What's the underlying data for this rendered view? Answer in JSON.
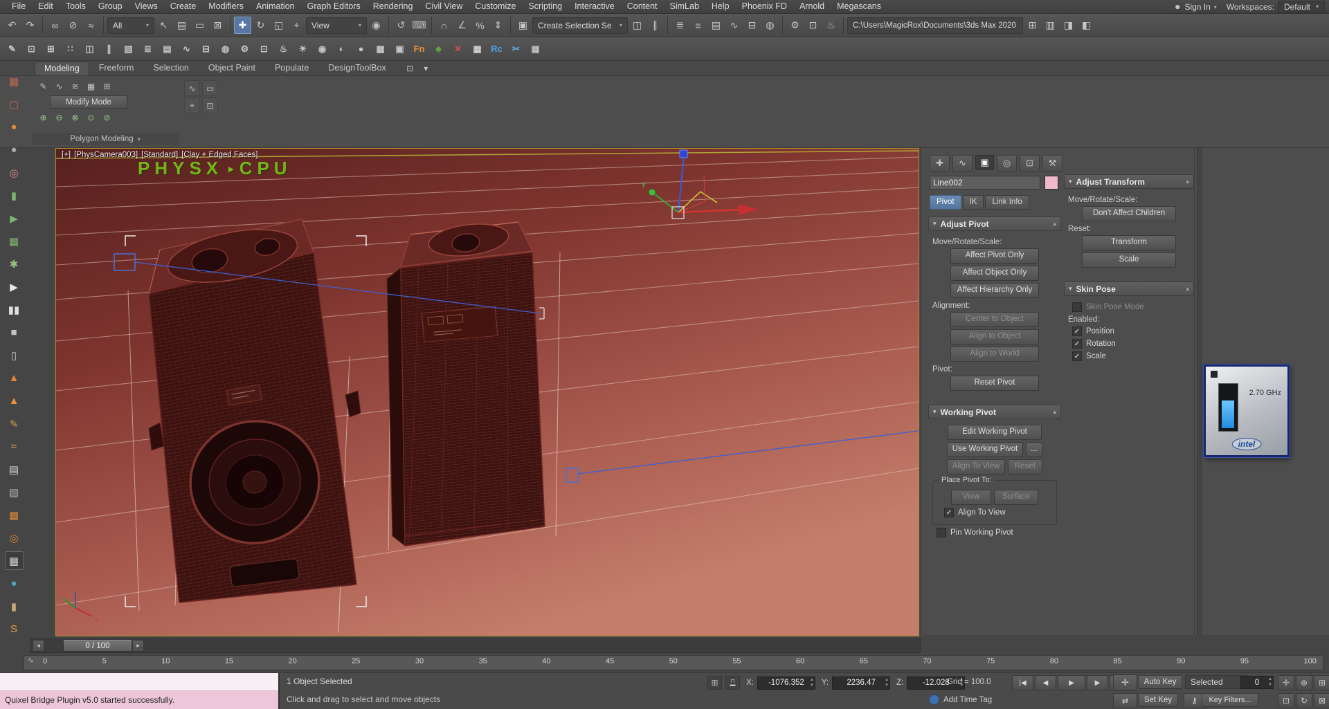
{
  "colors": {
    "active_tool_blue": "#5878a2",
    "viewport_border_yellow": "#b08f2e",
    "watermark_green": "#76b31c",
    "listener_pink": "#eec6da",
    "spline_blue": "#3e5fd0",
    "pivot_tab_blue": "#54749c",
    "cpu_bar_blue": "#1f8de0"
  },
  "menubar": {
    "items": [
      "File",
      "Edit",
      "Tools",
      "Group",
      "Views",
      "Create",
      "Modifiers",
      "Animation",
      "Graph Editors",
      "Rendering",
      "Civil View",
      "Customize",
      "Scripting",
      "Interactive",
      "Content",
      "SimLab",
      "Help",
      "Phoenix FD",
      "Arnold",
      "Megascans"
    ],
    "sign_in_label": "Sign In",
    "workspaces_label": "Workspaces:",
    "workspaces_value": "Default"
  },
  "toolbar_main": {
    "selection_filter_value": "All",
    "ref_coord_value": "View",
    "named_sets_value": "Create Selection Se",
    "project_path": "C:\\Users\\MagicRox\\Documents\\3ds Max 2020",
    "history_icons": [
      {
        "name": "undo-icon",
        "glyph": "↶"
      },
      {
        "name": "redo-icon",
        "glyph": "↷"
      }
    ],
    "link_icons": [
      {
        "name": "select-and-link-icon",
        "glyph": "∞"
      },
      {
        "name": "unlink-selection-icon",
        "glyph": "⊘"
      },
      {
        "name": "bind-to-space-warp-icon",
        "glyph": "≈"
      }
    ],
    "select_icons": [
      {
        "name": "select-object-icon",
        "glyph": "↖"
      },
      {
        "name": "select-by-name-icon",
        "glyph": "▤"
      },
      {
        "name": "rectangular-selection-region-icon",
        "glyph": "▭"
      },
      {
        "name": "window-crossing-icon",
        "glyph": "⊠"
      }
    ],
    "transform_icons": [
      {
        "name": "select-and-move-icon",
        "glyph": "✚",
        "active": true
      },
      {
        "name": "select-and-rotate-icon",
        "glyph": "↻"
      },
      {
        "name": "select-and-scale-icon",
        "glyph": "◱"
      },
      {
        "name": "select-and-place-icon",
        "glyph": "⌖"
      }
    ],
    "center_icons": [
      {
        "name": "use-pivot-point-center-icon",
        "glyph": "◉"
      }
    ],
    "manip_icons": [
      {
        "name": "select-and-manipulate-icon",
        "glyph": "↺"
      },
      {
        "name": "keyboard-shortcut-override-icon",
        "glyph": "⌨"
      }
    ],
    "snap_icons": [
      {
        "name": "snaps-toggle-icon",
        "glyph": "∩"
      },
      {
        "name": "angle-snap-icon",
        "glyph": "∠"
      },
      {
        "name": "percent-snap-icon",
        "glyph": "%"
      },
      {
        "name": "spinner-snap-icon",
        "glyph": "⇕"
      }
    ],
    "sets_icons": [
      {
        "name": "edit-named-selection-sets-icon",
        "glyph": "▣"
      }
    ],
    "mirror_icons": [
      {
        "name": "mirror-icon",
        "glyph": "◫"
      },
      {
        "name": "align-icon",
        "glyph": "∥"
      }
    ],
    "explorer_icons": [
      {
        "name": "scene-explorer-icon",
        "glyph": "≣"
      },
      {
        "name": "layer-explorer-icon",
        "glyph": "≡"
      },
      {
        "name": "ribbon-toggle-icon",
        "glyph": "▤"
      },
      {
        "name": "curve-editor-icon",
        "glyph": "∿"
      },
      {
        "name": "schematic-view-icon",
        "glyph": "⊟"
      },
      {
        "name": "material-editor-icon",
        "glyph": "◍"
      }
    ],
    "render_icons": [
      {
        "name": "render-setup-icon",
        "glyph": "⚙"
      },
      {
        "name": "rendered-frame-window-icon",
        "glyph": "⊡"
      },
      {
        "name": "render-production-icon",
        "glyph": "♨"
      }
    ],
    "end_icons": [
      {
        "name": "project-folder-icon",
        "glyph": "⊞"
      },
      {
        "name": "asset-library-icon",
        "glyph": "▥"
      },
      {
        "name": "import-icon",
        "glyph": "◨"
      },
      {
        "name": "export-icon",
        "glyph": "◧"
      }
    ]
  },
  "toolbar_secondary": {
    "icons": [
      {
        "name": "selection-paint-icon",
        "glyph": "✎"
      },
      {
        "name": "snapshot-icon",
        "glyph": "⊡"
      },
      {
        "name": "array-tool-icon",
        "glyph": "⊞"
      },
      {
        "name": "spacing-tool-icon",
        "glyph": "∷"
      },
      {
        "name": "mirror-tool-icon",
        "glyph": "◫"
      },
      {
        "name": "align-tool-icon",
        "glyph": "∥"
      },
      {
        "name": "color-clipboard-icon",
        "glyph": "▧"
      },
      {
        "name": "layer-manager-icon",
        "glyph": "≣"
      },
      {
        "name": "graphite-ribbon-icon",
        "glyph": "▤"
      },
      {
        "name": "curve-editor-2-icon",
        "glyph": "∿"
      },
      {
        "name": "schematic-view-2-icon",
        "glyph": "⊟"
      },
      {
        "name": "material-editor-2-icon",
        "glyph": "◍"
      },
      {
        "name": "render-setup-2-icon",
        "glyph": "⚙"
      },
      {
        "name": "rendered-frame-2-icon",
        "glyph": "⊡"
      },
      {
        "name": "render-teapot-icon",
        "glyph": "♨"
      },
      {
        "name": "light-tool-icon",
        "glyph": "☀"
      },
      {
        "name": "camera-tool-icon",
        "glyph": "◉"
      },
      {
        "name": "environment-icon",
        "glyph": "◐"
      },
      {
        "name": "sphere-preview-icon",
        "glyph": "●"
      },
      {
        "name": "uvw-edit-icon",
        "glyph": "▦"
      },
      {
        "name": "state-sets-icon",
        "glyph": "▣"
      },
      {
        "name": "plugin-fn-icon",
        "glyph": "Fn",
        "color": "#e8923a"
      },
      {
        "name": "forest-pack-icon",
        "glyph": "♣",
        "color": "#63b043"
      },
      {
        "name": "plugin-x-icon",
        "glyph": "✕",
        "color": "#d25050"
      },
      {
        "name": "grid-plugin-icon",
        "glyph": "▦",
        "color": "#cfcfcf"
      },
      {
        "name": "railclone-icon",
        "glyph": "Rc",
        "color": "#4f9fe0"
      },
      {
        "name": "scissors-plugin-icon",
        "glyph": "✂",
        "color": "#5fb3dc"
      },
      {
        "name": "grid2-plugin-icon",
        "glyph": "▦",
        "color": "#bdbdbd"
      }
    ]
  },
  "ribbon": {
    "tabs": [
      {
        "name": "tab-modeling",
        "label": "Modeling",
        "active": true
      },
      {
        "name": "tab-freeform",
        "label": "Freeform"
      },
      {
        "name": "tab-selection",
        "label": "Selection"
      },
      {
        "name": "tab-object-paint",
        "label": "Object Paint"
      },
      {
        "name": "tab-populate",
        "label": "Populate"
      },
      {
        "name": "tab-designtoolbox",
        "label": "DesignToolBox"
      }
    ],
    "config_icons": [
      {
        "name": "ribbon-config-icon",
        "glyph": "⊡"
      },
      {
        "name": "ribbon-minimize-icon",
        "glyph": "▾"
      }
    ],
    "poly_panel": {
      "tool_icons_top": [
        {
          "name": "edit-poly-mode-icon",
          "glyph": "✎"
        },
        {
          "name": "swift-loop-icon",
          "glyph": "∿"
        },
        {
          "name": "paint-connect-icon",
          "glyph": "≋"
        },
        {
          "name": "quad-cap-icon",
          "glyph": "▦"
        },
        {
          "name": "subdivide-icon",
          "glyph": "⊞"
        }
      ],
      "modify_mode_label": "Modify Mode",
      "tool_icons_bottom": [
        {
          "name": "attach-icon",
          "glyph": "⊕"
        },
        {
          "name": "detach-icon",
          "glyph": "⊖"
        },
        {
          "name": "collapse-icon",
          "glyph": "⊗"
        },
        {
          "name": "weld-icon",
          "glyph": "⊙"
        },
        {
          "name": "slice-icon",
          "glyph": "⊘"
        }
      ],
      "footer_label": "Polygon Modeling"
    },
    "extra_icons": [
      {
        "name": "freeform-tool-icon",
        "glyph": "∿"
      },
      {
        "name": "selection-tool-icon",
        "glyph": "▭"
      },
      {
        "name": "pivot-tool-icon",
        "glyph": "⌖"
      },
      {
        "name": "display-tool-icon",
        "glyph": "⊡"
      }
    ]
  },
  "left_toolbar": {
    "icons": [
      {
        "name": "cube-tool-icon",
        "glyph": "▦",
        "color": "#c06a55"
      },
      {
        "name": "cube-outline-icon",
        "glyph": "▢",
        "color": "#c06a55"
      },
      {
        "name": "sphere-orange-icon",
        "glyph": "●",
        "color": "#d98a3a"
      },
      {
        "name": "sphere-gray-icon",
        "glyph": "●",
        "color": "#a8a8a8"
      },
      {
        "name": "torus-pink-icon",
        "glyph": "◎",
        "color": "#d98a8a"
      },
      {
        "name": "capsule-green-icon",
        "glyph": "▮",
        "color": "#7fb370"
      },
      {
        "name": "arrow-green-icon",
        "glyph": "▶",
        "color": "#7fb370"
      },
      {
        "name": "grid-green-icon",
        "glyph": "▦",
        "color": "#7fb370"
      },
      {
        "name": "star-green-icon",
        "glyph": "✱",
        "color": "#8fc37f"
      },
      {
        "name": "play-icon",
        "glyph": "▶",
        "color": "#e8e8e8"
      },
      {
        "name": "pause-icon",
        "glyph": "▮▮",
        "color": "#e0e0e0"
      },
      {
        "name": "stop-icon",
        "glyph": "■",
        "color": "#c4c4c4"
      },
      {
        "name": "trash-icon",
        "glyph": "▯",
        "color": "#c4c4c4"
      },
      {
        "name": "flame-icon",
        "glyph": "▲",
        "color": "#e8833a"
      },
      {
        "name": "flame-sim-icon",
        "glyph": "▲",
        "color": "#e8933a"
      },
      {
        "name": "brush-orange-icon",
        "glyph": "✎",
        "color": "#d89a4a"
      },
      {
        "name": "wave-orange-icon",
        "glyph": "≈",
        "color": "#e8a04a"
      },
      {
        "name": "clipboard-icon",
        "glyph": "▤",
        "color": "#d8d8d8"
      },
      {
        "name": "panel-gray-icon",
        "glyph": "▧",
        "color": "#b0b0b0"
      },
      {
        "name": "box-orange-icon",
        "glyph": "▦",
        "color": "#d8893a"
      },
      {
        "name": "rings-orange-icon",
        "glyph": "◎",
        "color": "#d8893a"
      },
      {
        "name": "grid-snap-icon",
        "glyph": "▦",
        "color": "#d0d0d0",
        "active": true
      },
      {
        "name": "drop-teal-icon",
        "glyph": "●",
        "color": "#4aa8b8"
      },
      {
        "name": "barrel-icon",
        "glyph": "▮",
        "color": "#c8a878"
      },
      {
        "name": "s-orange-icon",
        "glyph": "S",
        "color": "#e8a04a"
      }
    ]
  },
  "viewport": {
    "label_plus": "[+]",
    "label_camera": "[PhysCamera003]",
    "label_style": "[Standard]",
    "label_shading": "[Clay + Edged Faces]",
    "watermark_primary": "PHYSX",
    "watermark_separator": "▸",
    "watermark_secondary": "CPU",
    "gizmo_axis_label": "Y",
    "tripod_axis_label": "x"
  },
  "command_panel": {
    "tab_icons": [
      {
        "name": "create-tab-icon",
        "glyph": "✚"
      },
      {
        "name": "modify-tab-icon",
        "glyph": "∿"
      },
      {
        "name": "hierarchy-tab-icon",
        "glyph": "▣",
        "active": true
      },
      {
        "name": "motion-tab-icon",
        "glyph": "◎"
      },
      {
        "name": "display-tab-icon",
        "glyph": "⊡"
      },
      {
        "name": "utilities-tab-icon",
        "glyph": "⚒"
      }
    ],
    "object_name": "Line002",
    "page_tabs": [
      {
        "name": "tab-pivot",
        "label": "Pivot",
        "active": true
      },
      {
        "name": "tab-ik",
        "label": "IK"
      },
      {
        "name": "tab-link-info",
        "label": "Link Info"
      }
    ],
    "adjust_pivot": {
      "title": "Adjust Pivot",
      "move_rotate_scale_label": "Move/Rotate/Scale:",
      "affect_pivot_only": "Affect Pivot Only",
      "affect_object_only": "Affect Object Only",
      "affect_hierarchy_only": "Affect Hierarchy Only",
      "alignment_label": "Alignment:",
      "center_to_object": "Center to Object",
      "align_to_object": "Align to Object",
      "align_to_world": "Align to World",
      "pivot_label": "Pivot:",
      "reset_pivot": "Reset Pivot"
    },
    "working_pivot": {
      "title": "Working Pivot",
      "edit_working_pivot": "Edit Working Pivot",
      "use_working_pivot": "Use Working Pivot",
      "dots": "...",
      "align_to_view_btn": "Align To View",
      "reset_btn": "Reset",
      "place_pivot_group": "Place Pivot To:",
      "view_btn": "View",
      "surface_btn": "Surface",
      "align_to_view_check": "Align To View",
      "pin_working_pivot": "Pin Working Pivot"
    },
    "adjust_transform": {
      "title": "Adjust Transform",
      "move_rotate_scale_label": "Move/Rotate/Scale:",
      "dont_affect_children": "Don't Affect Children",
      "reset_label": "Reset:",
      "transform_btn": "Transform",
      "scale_btn": "Scale"
    },
    "skin_pose": {
      "title": "Skin Pose",
      "skin_pose_mode": "Skin Pose Mode",
      "enabled_label": "Enabled:",
      "position": "Position",
      "rotation": "Rotation",
      "scale": "Scale"
    }
  },
  "cpu_widget": {
    "frequency": "2.70 GHz",
    "brand": "intel"
  },
  "timeline": {
    "slider_label": "0 / 100",
    "prev_arrow": "◂",
    "next_arrow": "▸",
    "ticks": [
      "0",
      "5",
      "10",
      "15",
      "20",
      "25",
      "30",
      "35",
      "40",
      "45",
      "50",
      "55",
      "60",
      "65",
      "70",
      "75",
      "80",
      "85",
      "90",
      "95",
      "100"
    ]
  },
  "statusbar": {
    "listener_message": "Quixel Bridge Plugin v5.0 started successfully.",
    "selection_status": "1 Object Selected",
    "prompt": "Click and drag to select and move objects",
    "x_label": "X:",
    "x_value": "-1076.352",
    "y_label": "Y:",
    "y_value": "2236.47",
    "z_label": "Z:",
    "z_value": "-12.028",
    "grid_label": "Grid = 100.0",
    "add_time_tag": "Add Time Tag",
    "auto_key_label": "Auto Key",
    "set_key_label": "Set Key",
    "selected_value": "Selected",
    "key_filters_label": "Key Filters...",
    "frame_value": "0",
    "playback_icons": [
      {
        "name": "go-to-start-button",
        "glyph": "|◀"
      },
      {
        "name": "previous-frame-button",
        "glyph": "◀"
      },
      {
        "name": "play-button",
        "glyph": "▶",
        "width": 32
      },
      {
        "name": "next-frame-button",
        "glyph": "▶"
      },
      {
        "name": "go-to-end-button",
        "glyph": "▶|"
      }
    ],
    "nav_icons_top": [
      {
        "name": "pan-icon",
        "glyph": "✛"
      },
      {
        "name": "zoom-icon",
        "glyph": "⊕"
      },
      {
        "name": "zoom-extents-icon",
        "glyph": "⊞"
      }
    ],
    "nav_icons_bottom": [
      {
        "name": "zoom-region-icon",
        "glyph": "⊡"
      },
      {
        "name": "orbit-icon",
        "glyph": "↻"
      },
      {
        "name": "maximize-viewport-icon",
        "glyph": "⊠"
      }
    ]
  }
}
